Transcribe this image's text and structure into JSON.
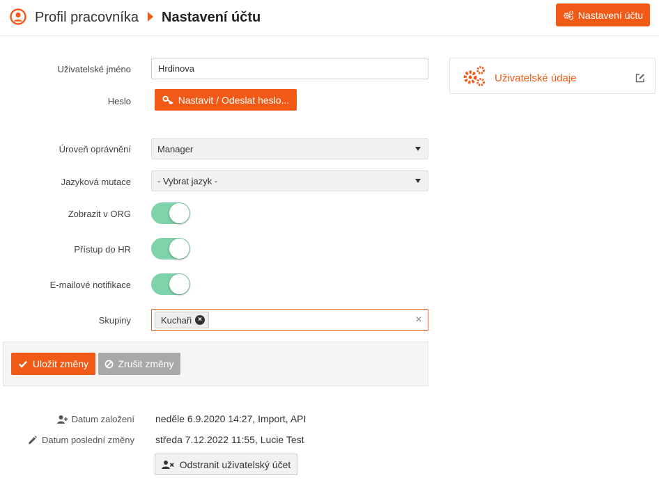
{
  "header": {
    "breadcrumb_parent": "Profil pracovníka",
    "breadcrumb_current": "Nastavení účtu",
    "top_button_label": "Nastavení účtu",
    "icons": {
      "user": "user-circle-icon",
      "arrow": "caret-right-icon",
      "top_button": "gears-icon"
    }
  },
  "form": {
    "username_label": "Uživatelské jméno",
    "username_value": "Hrdinova",
    "password_label": "Heslo",
    "password_button": "Nastavit / Odeslat heslo...",
    "permission_label": "Úroveň oprávnění",
    "permission_value": "Manager",
    "language_label": "Jazyková mutace",
    "language_value": "- Vybrat jazyk -",
    "show_org_label": "Zobrazit v ORG",
    "show_org_on": true,
    "hr_access_label": "Přístup do HR",
    "hr_access_on": true,
    "email_notif_label": "E-mailové notifikace",
    "email_notif_on": true,
    "groups_label": "Skupiny",
    "groups": [
      "Kuchaři"
    ],
    "groups_clear": "×",
    "tag_remove": "×"
  },
  "actions": {
    "save_label": "Uložit změny",
    "cancel_label": "Zrušit změny"
  },
  "meta": {
    "created_label": "Datum založení",
    "created_value": "neděle 6.9.2020 14:27, Import, API",
    "modified_label": "Datum poslední změny",
    "modified_value": "středa 7.12.2022 11:55, Lucie Test",
    "delete_label": "Odstranit uživatelský účet"
  },
  "panel": {
    "title": "Uživatelské údaje",
    "icons": {
      "main": "gears-icon",
      "edit": "edit-icon"
    }
  },
  "colors": {
    "accent": "#f05a16",
    "toggle_on": "#7ed3ab",
    "cancel_gray": "#a8a8a8"
  }
}
